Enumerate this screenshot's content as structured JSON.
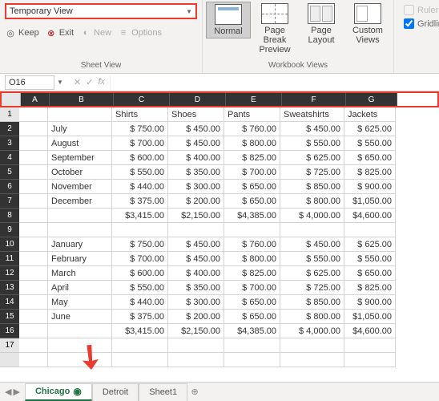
{
  "ribbon": {
    "view_dropdown": "Temporary View",
    "sheet_view": {
      "keep": "Keep",
      "exit": "Exit",
      "new": "New",
      "options": "Options",
      "label": "Sheet View"
    },
    "workbook_views": {
      "normal": "Normal",
      "page_break": "Page Break Preview",
      "page_layout": "Page Layout",
      "custom": "Custom Views",
      "label": "Workbook Views"
    },
    "show": {
      "ruler": "Ruler",
      "gridlines": "Gridlines"
    }
  },
  "name_box": "O16",
  "columns": [
    "A",
    "B",
    "C",
    "D",
    "E",
    "F",
    "G"
  ],
  "headers": {
    "c": "Shirts",
    "d": "Shoes",
    "e": "Pants",
    "f": "Sweatshirts",
    "g": "Jackets"
  },
  "rows": [
    {
      "n": 2,
      "b": "July",
      "c": "$   750.00",
      "d": "$   450.00",
      "e": "$   760.00",
      "f": "$   450.00",
      "g": "$   625.00"
    },
    {
      "n": 3,
      "b": "August",
      "c": "$   700.00",
      "d": "$   450.00",
      "e": "$   800.00",
      "f": "$   550.00",
      "g": "$   550.00"
    },
    {
      "n": 4,
      "b": "September",
      "c": "$   600.00",
      "d": "$   400.00",
      "e": "$   825.00",
      "f": "$   625.00",
      "g": "$   650.00"
    },
    {
      "n": 5,
      "b": "October",
      "c": "$   550.00",
      "d": "$   350.00",
      "e": "$   700.00",
      "f": "$   725.00",
      "g": "$   825.00"
    },
    {
      "n": 6,
      "b": "November",
      "c": "$   440.00",
      "d": "$   300.00",
      "e": "$   650.00",
      "f": "$   850.00",
      "g": "$   900.00"
    },
    {
      "n": 7,
      "b": "December",
      "c": "$   375.00",
      "d": "$   200.00",
      "e": "$   650.00",
      "f": "$   800.00",
      "g": "$1,050.00"
    },
    {
      "n": 8,
      "b": "",
      "c": "$3,415.00",
      "d": "$2,150.00",
      "e": "$4,385.00",
      "f": "$ 4,000.00",
      "g": "$4,600.00"
    },
    {
      "n": 9,
      "b": "",
      "c": "",
      "d": "",
      "e": "",
      "f": "",
      "g": ""
    },
    {
      "n": 10,
      "b": "January",
      "c": "$   750.00",
      "d": "$   450.00",
      "e": "$   760.00",
      "f": "$   450.00",
      "g": "$   625.00"
    },
    {
      "n": 11,
      "b": "February",
      "c": "$   700.00",
      "d": "$   450.00",
      "e": "$   800.00",
      "f": "$   550.00",
      "g": "$   550.00"
    },
    {
      "n": 12,
      "b": "March",
      "c": "$   600.00",
      "d": "$   400.00",
      "e": "$   825.00",
      "f": "$   625.00",
      "g": "$   650.00"
    },
    {
      "n": 13,
      "b": "April",
      "c": "$   550.00",
      "d": "$   350.00",
      "e": "$   700.00",
      "f": "$   725.00",
      "g": "$   825.00"
    },
    {
      "n": 14,
      "b": "May",
      "c": "$   440.00",
      "d": "$   300.00",
      "e": "$   650.00",
      "f": "$   850.00",
      "g": "$   900.00"
    },
    {
      "n": 15,
      "b": "June",
      "c": "$   375.00",
      "d": "$   200.00",
      "e": "$   650.00",
      "f": "$   800.00",
      "g": "$1,050.00"
    },
    {
      "n": 16,
      "b": "",
      "c": "$3,415.00",
      "d": "$2,150.00",
      "e": "$4,385.00",
      "f": "$ 4,000.00",
      "g": "$4,600.00"
    }
  ],
  "tabs": {
    "active": "Chicago",
    "others": [
      "Detroit",
      "Sheet1"
    ]
  }
}
